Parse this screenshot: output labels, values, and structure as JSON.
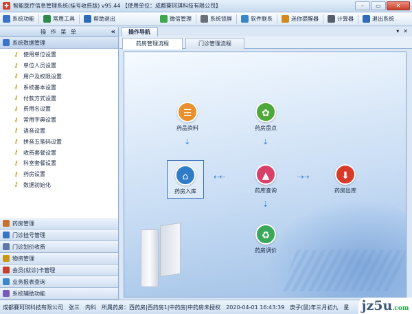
{
  "window": {
    "title": "智能医疗信息管理系统(挂号收费版) v95.44   【使用单位：成都賽珂琪科技有限公司】",
    "controls": [
      "–",
      "▭",
      "✕"
    ]
  },
  "toolbar": {
    "left": [
      {
        "id": "system-function",
        "label": "系统功能",
        "icon": "grid-icon",
        "color": "#3a74c8"
      },
      {
        "id": "common-tools",
        "label": "常用工具",
        "icon": "tools-icon",
        "color": "#2f8a4a"
      },
      {
        "id": "help-exit",
        "label": "帮助退出",
        "icon": "help-icon",
        "color": "#2d6bb8"
      }
    ],
    "right": [
      {
        "id": "wechat",
        "label": "微信管理",
        "icon": "wechat-icon",
        "color": "#3ba84a"
      },
      {
        "id": "lock",
        "label": "系统锁屏",
        "icon": "lock-icon",
        "color": "#6a6f7a"
      },
      {
        "id": "software",
        "label": "软件联系",
        "icon": "contact-icon",
        "color": "#3a86c8"
      },
      {
        "id": "reminder",
        "label": "迷你提醒器",
        "icon": "reminder-icon",
        "color": "#d28a1c"
      },
      {
        "id": "calculator",
        "label": "计算器",
        "icon": "calculator-icon",
        "color": "#555d6b"
      },
      {
        "id": "exit",
        "label": "退出系统",
        "icon": "exit-icon",
        "color": "#2d6bb8"
      }
    ]
  },
  "sidebar": {
    "header": "操 作 菜 单",
    "collapse": "«",
    "active_section": "系统数据管理",
    "items": [
      "使用单位设置",
      "单位人员设置",
      "用户及权限设置",
      "系统基本设置",
      "付款方式设置",
      "费用名设置",
      "常用字典设置",
      "语音设置",
      "拼音五笔码设置",
      "收费套餐设置",
      "科室套餐设置",
      "药房设置",
      "数据初始化"
    ],
    "sections": [
      {
        "label": "药房管理",
        "color": "#c9712a"
      },
      {
        "label": "门诊挂号管理",
        "color": "#3a74c8"
      },
      {
        "label": "门诊划价收费",
        "color": "#5a7aa8"
      },
      {
        "label": "物资管理",
        "color": "#c99712"
      },
      {
        "label": "会员(就诊)卡管理",
        "color": "#c8402a"
      },
      {
        "label": "业务报表查询",
        "color": "#3a86c8"
      },
      {
        "label": "系统辅助功能",
        "color": "#7a5ab8"
      }
    ]
  },
  "main": {
    "nav_tab": "操作导航",
    "controls": [
      "▾",
      "✕"
    ],
    "tabs": [
      "药房管理流程",
      "门诊管理流程"
    ],
    "active_tab": 0,
    "nodes": [
      {
        "id": "drug-info",
        "label": "药品资料",
        "icon": "book-icon",
        "glyph": "☰",
        "color": "#e8902c"
      },
      {
        "id": "stock-check",
        "label": "药房盘点",
        "icon": "wheel-icon",
        "glyph": "✿",
        "color": "#4fa83a"
      },
      {
        "id": "stock-in",
        "label": "药房入库",
        "icon": "home-icon",
        "glyph": "⌂",
        "color": "#2f7cc8"
      },
      {
        "id": "stock-query",
        "label": "药库查询",
        "icon": "chart-icon",
        "glyph": "▲",
        "color": "#d8406a"
      },
      {
        "id": "stock-out",
        "label": "药房出库",
        "icon": "download-icon",
        "glyph": "⬇",
        "color": "#d83a2a"
      },
      {
        "id": "transfer",
        "label": "药房调价",
        "icon": "recycle-icon",
        "glyph": "♻",
        "color": "#3aa85a"
      }
    ]
  },
  "status": {
    "company": "成都賽珂琪科技有限公司",
    "user": "张三",
    "dept": "内科",
    "pharmacy": "所属药房：西药房|西药房1|中药房|中药房未授权",
    "datetime": "2020-04-01 16:43:39",
    "lunar": "庚子(鼠)年三月初九",
    "weekday": "星"
  },
  "watermark": {
    "text": "jz5u",
    "suffix": ".com"
  }
}
